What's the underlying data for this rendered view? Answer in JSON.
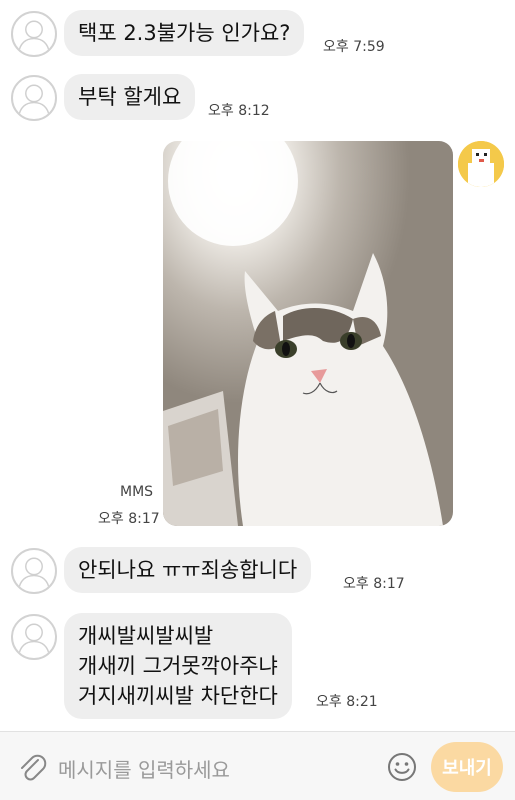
{
  "messages": [
    {
      "text": "택포 2.3불가능 인가요?",
      "time": "오후 7:59"
    },
    {
      "text": "부탁 할게요",
      "time": "오후 8:12"
    },
    {
      "text": "안되나요 ㅠㅠ죄송합니다",
      "time": "오후 8:17"
    },
    {
      "lines": [
        "개씨발씨발씨발",
        "개새끼 그거못깍아주냐",
        "거지새끼씨발 차단한다"
      ],
      "time": "오후 8:21"
    }
  ],
  "sent_photo": {
    "type_label": "MMS",
    "time": "오후 8:17"
  },
  "input": {
    "placeholder": "메시지를 입력하세요",
    "send_label": "보내기"
  },
  "colors": {
    "bubble": "#eeeeee",
    "send_button": "#fbd9a2",
    "avatar_outline": "#d2d2d2"
  },
  "icons": [
    "default-profile-icon",
    "attach-clip-icon",
    "emoji-icon",
    "send-button"
  ]
}
